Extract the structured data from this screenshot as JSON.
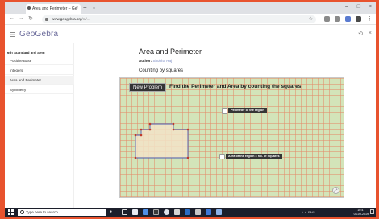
{
  "browser": {
    "tab_title": "Area and Perimeter – Ge",
    "tab_close": "×",
    "new_tab": "+",
    "tab_dropdown": "⌄",
    "address_domain": "www.geogebra.org",
    "address_path": "/m/...",
    "star": "☆"
  },
  "app": {
    "logo": "GeoGebra",
    "menu_icon": "hamburger-icon",
    "share_icon": "share-icon",
    "close_icon": "close-icon"
  },
  "sidebar": {
    "heading": "6th Standard 3rd Sem",
    "items": [
      {
        "label": "Positive Base"
      },
      {
        "label": "Integers"
      },
      {
        "label": "Area and Perimeter"
      },
      {
        "label": "Symmetry"
      }
    ]
  },
  "content": {
    "title": "Area and Perimeter",
    "author_label": "Author:",
    "author_name": "Shobha Raj",
    "subtitle": "Counting by squares"
  },
  "applet": {
    "problem_button": "New Problem",
    "instruction": "Find the Perimeter and Area by counting the squares",
    "checkbox_perimeter": "Perimeter of the region",
    "checkbox_area": "Area of the region = No. of Squares",
    "zoom_icon": "fullscreen-icon"
  },
  "taskbar": {
    "search_placeholder": "Type here to search",
    "time": "10:47",
    "date": "03-09-2019",
    "tray_text": "^  ▲  ENG"
  },
  "colors": {
    "accent": "#6a6a9a",
    "grid_bg": "#d3e4b9",
    "grid_line": "#e48c6c",
    "shape_fill": "#f2e3c7",
    "taskbar": "#1c1f2b"
  }
}
